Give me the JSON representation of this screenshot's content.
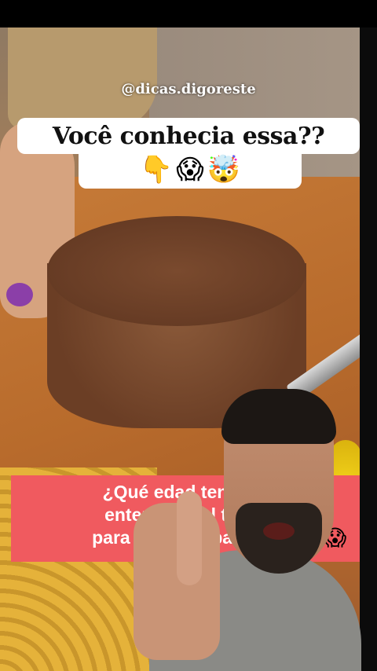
{
  "video": {
    "handle": "@dicas.digoreste",
    "caption": "Você conhecia essa??",
    "emojis": [
      "👇",
      "😱",
      "🤯"
    ],
    "subtitle_lines": [
      "¿Qué edad tenías c",
      "enteraste del truco",
      "para cortar el pan el e"
    ],
    "subtitle_emoji": "😱"
  },
  "colors": {
    "caption_bg": "#ffffff",
    "subtitle_bg": "#f05a5f",
    "subtitle_text": "#ffffff"
  }
}
